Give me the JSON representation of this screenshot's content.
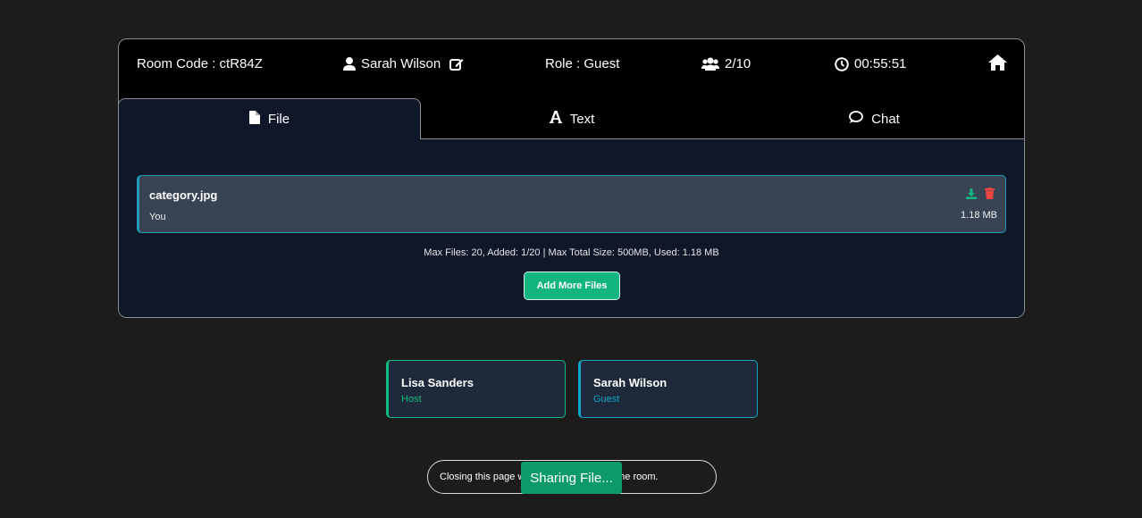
{
  "header": {
    "room_code": "Room Code : ctR84Z",
    "user_name": "Sarah Wilson",
    "role": "Role : Guest",
    "participants": "2/10",
    "timer": "00:55:51",
    "icons": [
      "user-icon",
      "edit-icon",
      "users-icon",
      "clock-icon",
      "home-icon"
    ]
  },
  "tabs": [
    {
      "label": "File",
      "icon": "file-icon",
      "active": true
    },
    {
      "label": "Text",
      "icon": "text-icon",
      "active": false
    },
    {
      "label": "Chat",
      "icon": "chat-icon",
      "active": false
    }
  ],
  "files": [
    {
      "name": "category.jpg",
      "owner": "You",
      "size": "1.18 MB"
    }
  ],
  "limits_text": "Max Files: 20, Added: 1/20 | Max Total Size: 500MB, Used: 1.18 MB",
  "add_button_label": "Add More Files",
  "members": [
    {
      "name": "Lisa Sanders",
      "role": "Host"
    },
    {
      "name": "Sarah Wilson",
      "role": "Guest"
    }
  ],
  "notice_text": "Closing this page will permanently close the room.",
  "toast_text": "Sharing File...",
  "colors": {
    "background": "#1c1c1c",
    "panel": "#0f1729",
    "accent_green": "#10b981",
    "accent_cyan": "#0ea5c6",
    "delete_red": "#ef4444"
  }
}
